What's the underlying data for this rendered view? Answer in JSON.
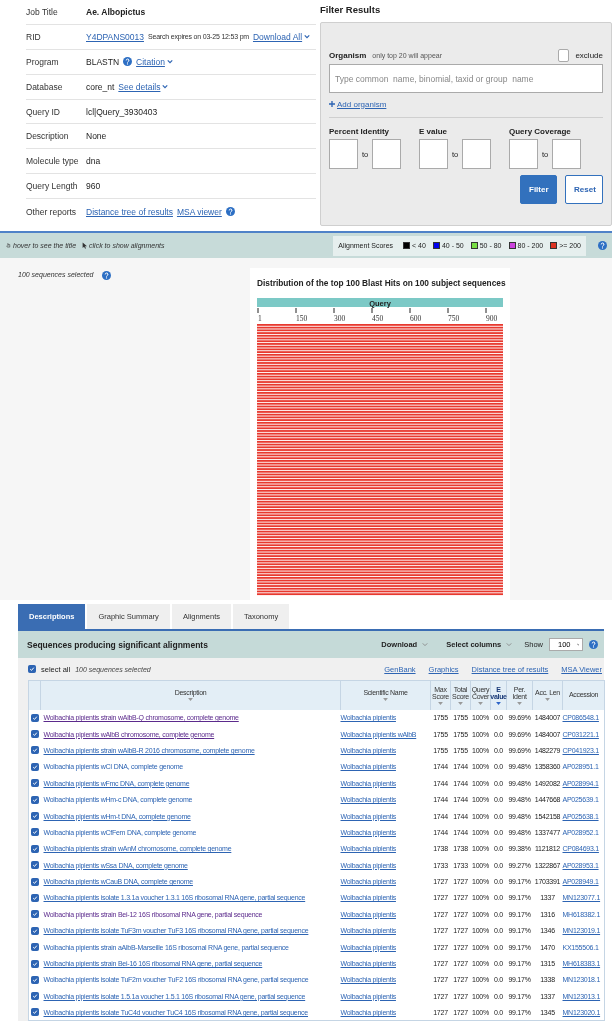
{
  "job_info": [
    {
      "label": "Job Title",
      "parts": [
        {
          "kind": "strong",
          "text": "Ae. Albopictus"
        }
      ]
    },
    {
      "label": "RID",
      "parts": [
        {
          "kind": "link",
          "text": "Y4DPANS0013"
        },
        {
          "kind": "note",
          "text": "Search expires on 03-25 12:53 pm"
        },
        {
          "kind": "menu_link",
          "text": "Download All"
        }
      ]
    },
    {
      "label": "Program",
      "parts": [
        {
          "kind": "text",
          "text": "BLASTN"
        },
        {
          "kind": "help"
        },
        {
          "kind": "menu_link",
          "text": "Citation"
        }
      ]
    },
    {
      "label": "Database",
      "parts": [
        {
          "kind": "text",
          "text": "core_nt"
        },
        {
          "kind": "menu_link",
          "text": "See details"
        }
      ]
    },
    {
      "label": "Query ID",
      "parts": [
        {
          "kind": "text",
          "text": "lcl|Query_3930403"
        }
      ]
    },
    {
      "label": "Description",
      "parts": [
        {
          "kind": "text",
          "text": "None"
        }
      ]
    },
    {
      "label": "Molecule type",
      "parts": [
        {
          "kind": "text",
          "text": "dna"
        }
      ]
    },
    {
      "label": "Query Length",
      "parts": [
        {
          "kind": "text",
          "text": "960"
        }
      ]
    },
    {
      "label": "Other reports",
      "parts": [
        {
          "kind": "link",
          "text": "Distance tree of results"
        },
        {
          "kind": "link",
          "text": "MSA viewer"
        },
        {
          "kind": "help"
        }
      ]
    }
  ],
  "filter": {
    "title": "Filter Results",
    "organism": {
      "label": "Organism",
      "note": "only top 20 will appear",
      "exclude": {
        "label": "exclude",
        "checked": false
      },
      "placeholder": "Type common  name, binomial, taxid or group  name",
      "add_link": "Add organism"
    },
    "ranges": [
      {
        "label": "Percent Identity",
        "separator": "to"
      },
      {
        "label": "E value",
        "separator": "to"
      },
      {
        "label": "Query Coverage",
        "separator": "to"
      }
    ],
    "buttons": [
      {
        "label": "Filter",
        "kind": "primary"
      },
      {
        "label": "Reset",
        "kind": "secondary"
      }
    ]
  },
  "toolbar": {
    "hints": [
      {
        "kind": "hover",
        "text": "hover to see the title"
      },
      {
        "kind": "click",
        "text": "click to show alignments"
      }
    ],
    "legend": {
      "label": "Alignment Scores",
      "items": [
        {
          "label": "< 40",
          "color": "#000000"
        },
        {
          "label": "40 - 50",
          "color": "#0000ee"
        },
        {
          "label": "50 - 80",
          "color": "#77dd44"
        },
        {
          "label": "80 - 200",
          "color": "#cc44dd"
        },
        {
          "label": ">= 200",
          "color": "#dd3322"
        }
      ]
    }
  },
  "graphic": {
    "selected_note": "100 sequences selected",
    "title": "Distribution of the top 100 Blast Hits on 100 subject sequences",
    "query_label": "Query",
    "ticks": [
      "1",
      "150",
      "300",
      "450",
      "600",
      "750",
      "900"
    ]
  },
  "results": {
    "tabs": [
      {
        "label": "Descriptions",
        "selected": true
      },
      {
        "label": "Graphic Summary",
        "selected": false
      },
      {
        "label": "Alignments",
        "selected": false
      },
      {
        "label": "Taxonomy",
        "selected": false
      }
    ],
    "title": "Sequences producing significant alignments",
    "menus": [
      "Download",
      "Select columns"
    ],
    "show": {
      "label": "Show",
      "value": "100"
    },
    "select_all": {
      "label": "select all",
      "checked": true
    },
    "selected_note": "100 sequences selected",
    "links": [
      "GenBank",
      "Graphics",
      "Distance tree of results",
      "MSA Viewer"
    ],
    "columns": [
      {
        "label": "Description",
        "sortable": true,
        "sorted": false
      },
      {
        "label": "Scientific Name",
        "sortable": true,
        "sorted": false
      },
      {
        "label": "Max Score",
        "sortable": true,
        "sorted": false
      },
      {
        "label": "Total Score",
        "sortable": true,
        "sorted": false
      },
      {
        "label": "Query Cover",
        "sortable": true,
        "sorted": false
      },
      {
        "label": "E value",
        "sortable": true,
        "sorted": true
      },
      {
        "label": "Per. Ident",
        "sortable": true,
        "sorted": false
      },
      {
        "label": "Acc. Len",
        "sortable": true,
        "sorted": false
      },
      {
        "label": "Accession",
        "sortable": false,
        "sorted": false
      }
    ],
    "rows": [
      {
        "checked": true,
        "visited": true,
        "underlined": true,
        "description": "Wolbachia pipientis strain wAlbB-Q chromosome, complete genome",
        "scientific_name": "Wolbachia pipientis",
        "max_score": "1755",
        "total_score": "1755",
        "query_cover": "100%",
        "e_value": "0.0",
        "per_ident": "99.69%",
        "acc_len": "1484007",
        "accession": "CP086548.1"
      },
      {
        "checked": true,
        "visited": true,
        "underlined": true,
        "description": "Wolbachia pipientis wAlbB chromosome, complete genome",
        "scientific_name": "Wolbachia pipientis wAlbB",
        "max_score": "1755",
        "total_score": "1755",
        "query_cover": "100%",
        "e_value": "0.0",
        "per_ident": "99.69%",
        "acc_len": "1484007",
        "accession": "CP031221.1"
      },
      {
        "checked": true,
        "visited": false,
        "underlined": true,
        "description": "Wolbachia pipientis strain wAlbB-R 2016 chromosome, complete genome",
        "scientific_name": "Wolbachia pipientis",
        "max_score": "1755",
        "total_score": "1755",
        "query_cover": "100%",
        "e_value": "0.0",
        "per_ident": "99.69%",
        "acc_len": "1482279",
        "accession": "CP041923.1"
      },
      {
        "checked": true,
        "visited": false,
        "underlined": false,
        "description": "Wolbachia pipientis wCI DNA, complete genome",
        "scientific_name": "Wolbachia pipientis",
        "max_score": "1744",
        "total_score": "1744",
        "query_cover": "100%",
        "e_value": "0.0",
        "per_ident": "99.48%",
        "acc_len": "1358360",
        "accession": "AP028951.1"
      },
      {
        "checked": true,
        "visited": false,
        "underlined": true,
        "description": "Wolbachia pipientis wFmc DNA, complete genome",
        "scientific_name": "Wolbachia pipientis",
        "max_score": "1744",
        "total_score": "1744",
        "query_cover": "100%",
        "e_value": "0.0",
        "per_ident": "99.48%",
        "acc_len": "1492082",
        "accession": "AP028994.1"
      },
      {
        "checked": true,
        "visited": false,
        "underlined": false,
        "description": "Wolbachia pipientis wHm-c DNA, complete genome",
        "scientific_name": "Wolbachia pipientis",
        "max_score": "1744",
        "total_score": "1744",
        "query_cover": "100%",
        "e_value": "0.0",
        "per_ident": "99.48%",
        "acc_len": "1447668",
        "accession": "AP025639.1"
      },
      {
        "checked": true,
        "visited": false,
        "underlined": true,
        "description": "Wolbachia pipientis wHm-t DNA, complete genome",
        "scientific_name": "Wolbachia pipientis",
        "max_score": "1744",
        "total_score": "1744",
        "query_cover": "100%",
        "e_value": "0.0",
        "per_ident": "99.48%",
        "acc_len": "1542158",
        "accession": "AP025638.1"
      },
      {
        "checked": true,
        "visited": false,
        "underlined": false,
        "description": "Wolbachia pipientis wCfFem DNA, complete genome",
        "scientific_name": "Wolbachia pipientis",
        "max_score": "1744",
        "total_score": "1744",
        "query_cover": "100%",
        "e_value": "0.0",
        "per_ident": "99.48%",
        "acc_len": "1337477",
        "accession": "AP028952.1"
      },
      {
        "checked": true,
        "visited": false,
        "underlined": true,
        "description": "Wolbachia pipientis strain wAnM chromosome, complete genome",
        "scientific_name": "Wolbachia pipientis",
        "max_score": "1738",
        "total_score": "1738",
        "query_cover": "100%",
        "e_value": "0.0",
        "per_ident": "99.38%",
        "acc_len": "1121812",
        "accession": "CP084693.1"
      },
      {
        "checked": true,
        "visited": false,
        "underlined": true,
        "description": "Wolbachia pipientis wSsa DNA, complete genome",
        "scientific_name": "Wolbachia pipientis",
        "max_score": "1733",
        "total_score": "1733",
        "query_cover": "100%",
        "e_value": "0.0",
        "per_ident": "99.27%",
        "acc_len": "1322867",
        "accession": "AP028953.1"
      },
      {
        "checked": true,
        "visited": false,
        "underlined": true,
        "description": "Wolbachia pipientis wCauB DNA, complete genome",
        "scientific_name": "Wolbachia pipientis",
        "max_score": "1727",
        "total_score": "1727",
        "query_cover": "100%",
        "e_value": "0.0",
        "per_ident": "99.17%",
        "acc_len": "1703391",
        "accession": "AP028949.1"
      },
      {
        "checked": true,
        "visited": false,
        "underlined": true,
        "description": "Wolbachia pipientis isolate 1.3.1a voucher 1.3.1 16S ribosomal RNA gene, partial sequence",
        "scientific_name": "Wolbachia pipientis",
        "max_score": "1727",
        "total_score": "1727",
        "query_cover": "100%",
        "e_value": "0.0",
        "per_ident": "99.17%",
        "acc_len": "1337",
        "accession": "MN123077.1"
      },
      {
        "checked": true,
        "visited": true,
        "underlined": false,
        "description": "Wolbachia pipientis strain Bei-12 16S ribosomal RNA gene, partial sequence",
        "scientific_name": "Wolbachia pipientis",
        "max_score": "1727",
        "total_score": "1727",
        "query_cover": "100%",
        "e_value": "0.0",
        "per_ident": "99.17%",
        "acc_len": "1316",
        "accession": "MH618382.1"
      },
      {
        "checked": true,
        "visited": false,
        "underlined": true,
        "description": "Wolbachia pipientis isolate TuF3m voucher TuF3 16S ribosomal RNA gene, partial sequence",
        "scientific_name": "Wolbachia pipientis",
        "max_score": "1727",
        "total_score": "1727",
        "query_cover": "100%",
        "e_value": "0.0",
        "per_ident": "99.17%",
        "acc_len": "1346",
        "accession": "MN123019.1"
      },
      {
        "checked": true,
        "visited": false,
        "underlined": false,
        "description": "Wolbachia pipientis strain aAlbB-Marseille 16S ribosomal RNA gene, partial sequence",
        "scientific_name": "Wolbachia pipientis",
        "max_score": "1727",
        "total_score": "1727",
        "query_cover": "100%",
        "e_value": "0.0",
        "per_ident": "99.17%",
        "acc_len": "1470",
        "accession": "KX155506.1"
      },
      {
        "checked": true,
        "visited": false,
        "underlined": true,
        "description": "Wolbachia pipientis strain Bei-16 16S ribosomal RNA gene, partial sequence",
        "scientific_name": "Wolbachia pipientis",
        "max_score": "1727",
        "total_score": "1727",
        "query_cover": "100%",
        "e_value": "0.0",
        "per_ident": "99.17%",
        "acc_len": "1315",
        "accession": "MH618383.1"
      },
      {
        "checked": true,
        "visited": false,
        "underlined": false,
        "description": "Wolbachia pipientis isolate TuF2m voucher TuF2 16S ribosomal RNA gene, partial sequence",
        "scientific_name": "Wolbachia pipientis",
        "max_score": "1727",
        "total_score": "1727",
        "query_cover": "100%",
        "e_value": "0.0",
        "per_ident": "99.17%",
        "acc_len": "1338",
        "accession": "MN123018.1"
      },
      {
        "checked": true,
        "visited": false,
        "underlined": true,
        "description": "Wolbachia pipientis isolate 1.5.1a voucher 1.5.1 16S ribosomal RNA gene, partial sequence",
        "scientific_name": "Wolbachia pipientis",
        "max_score": "1727",
        "total_score": "1727",
        "query_cover": "100%",
        "e_value": "0.0",
        "per_ident": "99.17%",
        "acc_len": "1337",
        "accession": "MN123013.1"
      },
      {
        "checked": true,
        "visited": false,
        "underlined": true,
        "description": "Wolbachia pipientis isolate TuC4d voucher TuC4 16S ribosomal RNA gene, partial sequence",
        "scientific_name": "Wolbachia pipientis",
        "max_score": "1727",
        "total_score": "1727",
        "query_cover": "100%",
        "e_value": "0.0",
        "per_ident": "99.17%",
        "acc_len": "1345",
        "accession": "MN123020.1"
      }
    ]
  }
}
